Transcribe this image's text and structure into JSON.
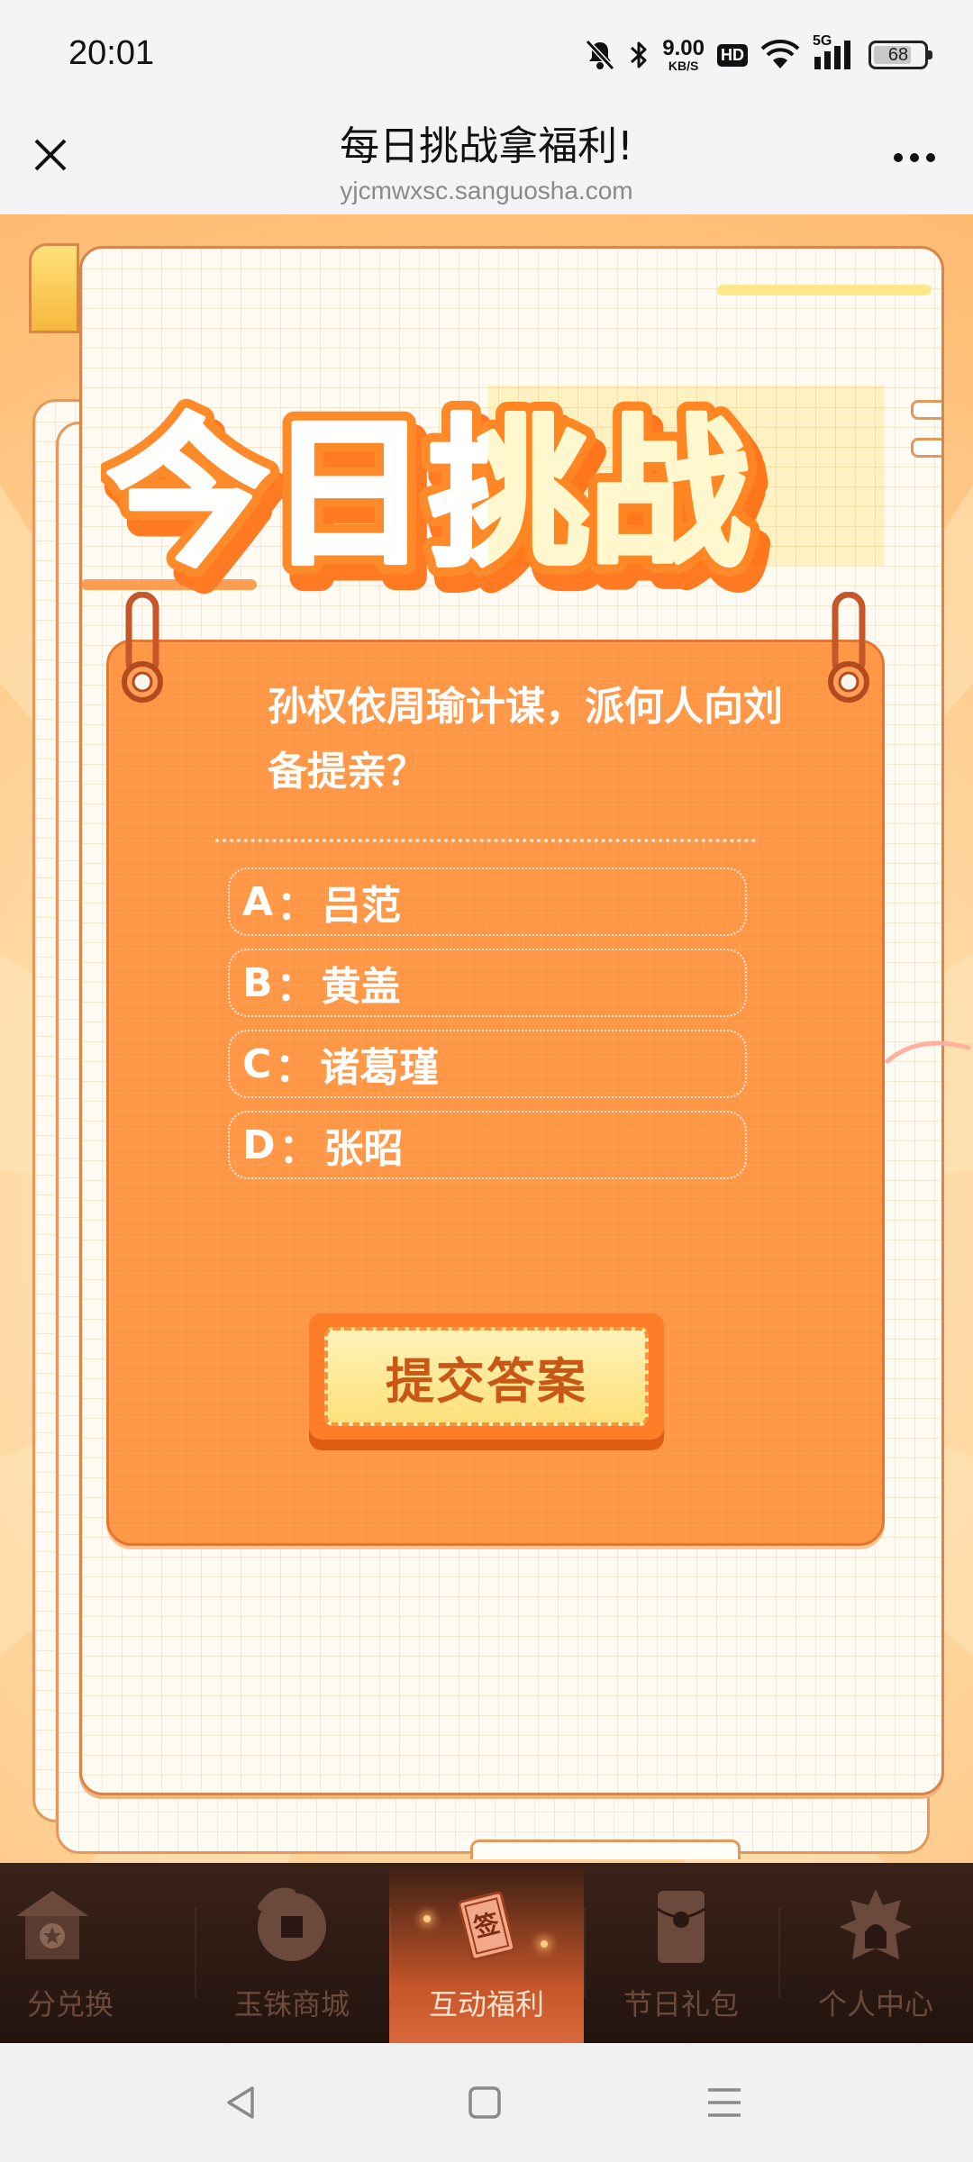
{
  "status_bar": {
    "time": "20:01",
    "net_speed_value": "9.00",
    "net_speed_unit": "KB/S",
    "hd_label": "HD",
    "network_label": "5G",
    "battery_level": "68",
    "icons": [
      "mute-bell-icon",
      "bluetooth-icon",
      "wifi-icon",
      "signal-icon",
      "battery-icon"
    ]
  },
  "title_bar": {
    "title": "每日挑战拿福利!",
    "url": "yjcmwxsc.sanguosha.com",
    "icons": [
      "close-icon",
      "more-icon"
    ]
  },
  "challenge": {
    "banner_title": "今日挑战",
    "question": "孙权依周瑜计谋，派何人向刘备提亲？",
    "separator": "：",
    "options": [
      {
        "letter": "A",
        "text": "吕范"
      },
      {
        "letter": "B",
        "text": "黄盖"
      },
      {
        "letter": "C",
        "text": "诸葛瑾"
      },
      {
        "letter": "D",
        "text": "张昭"
      }
    ],
    "submit_label": "提交答案"
  },
  "tabbar": {
    "items": [
      {
        "label": "分兑换",
        "icon": "palace-icon",
        "active": false
      },
      {
        "label": "玉铢商城",
        "icon": "coin-icon",
        "active": false
      },
      {
        "label": "互动福利",
        "icon": "sign-card-icon",
        "badge": "签",
        "active": true
      },
      {
        "label": "节日礼包",
        "icon": "gift-envelope-icon",
        "active": false
      },
      {
        "label": "个人中心",
        "icon": "helmet-icon",
        "active": false
      }
    ]
  },
  "navbar": {
    "icons": [
      "back-icon",
      "home-icon",
      "menu-icon"
    ]
  },
  "colors": {
    "card_orange": "#ff9747",
    "title_orange": "#ff7a22",
    "title_yellow": "#ffd23c",
    "tab_active": "#c7562b",
    "tab_bar": "#2c1812"
  }
}
